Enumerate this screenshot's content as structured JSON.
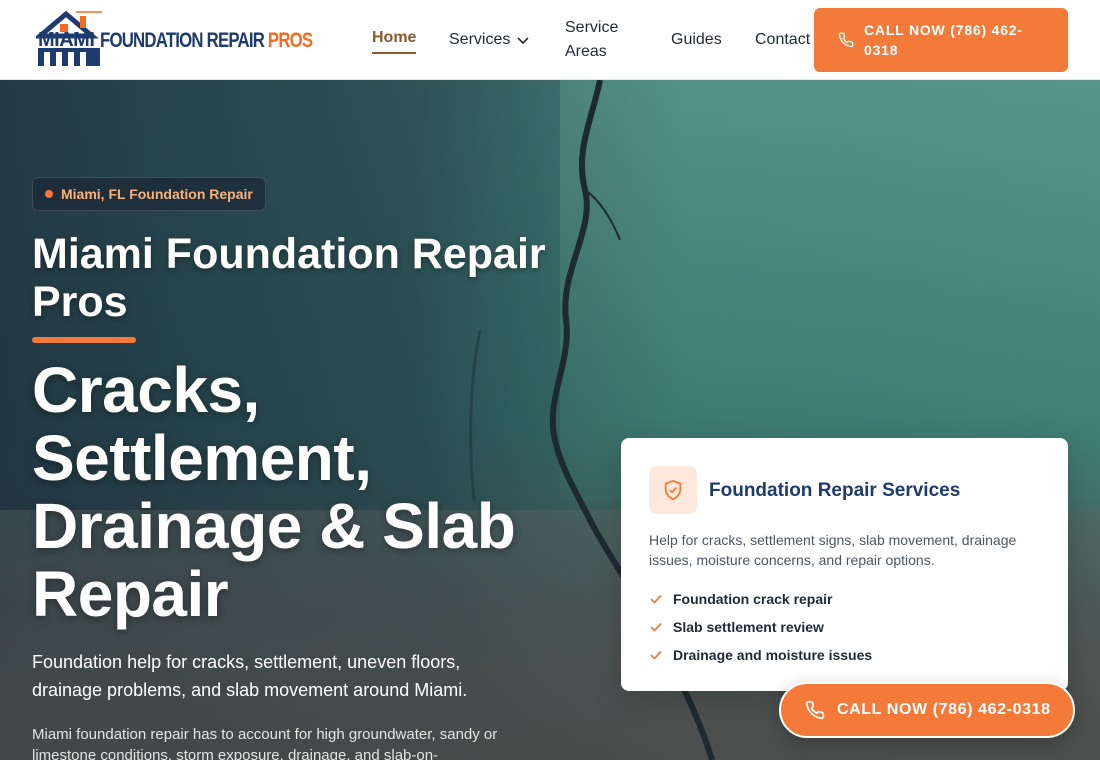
{
  "brand": {
    "logo_top": "MIAMI",
    "logo_main": "FOUNDATION REPAIR",
    "logo_accent": "PROS",
    "colors": {
      "navy": "#1e3a6e",
      "orange": "#f47a3a",
      "home_link": "#8a5a2b"
    }
  },
  "nav": {
    "home": "Home",
    "services": "Services",
    "service_areas": "Service Areas",
    "guides": "Guides",
    "contact": "Contact"
  },
  "header_cta": {
    "label": "CALL NOW (786) 462-0318",
    "icon": "phone-icon"
  },
  "hero": {
    "badge": "Miami, FL Foundation Repair",
    "title": "Miami Foundation Repair Pros",
    "headline": "Cracks, Settlement, Drainage & Slab Repair",
    "lead": "Foundation help for cracks, settlement, uneven floors, drainage problems, and slab movement around Miami.",
    "paragraph": "Miami foundation repair has to account for high groundwater, sandy or limestone conditions, storm exposure, drainage, and slab-on-"
  },
  "card": {
    "icon": "shield-check-icon",
    "title": "Foundation Repair Services",
    "description": "Help for cracks, settlement signs, slab movement, drainage issues, moisture concerns, and repair options.",
    "items": [
      "Foundation crack repair",
      "Slab settlement review",
      "Drainage and moisture issues"
    ]
  },
  "floating_cta": {
    "label": "CALL NOW (786) 462-0318",
    "icon": "phone-icon"
  }
}
